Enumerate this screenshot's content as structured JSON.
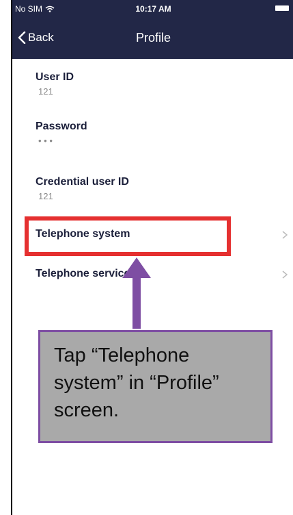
{
  "status_bar": {
    "carrier": "No SIM",
    "time": "10:17 AM"
  },
  "nav": {
    "back_label": "Back",
    "title": "Profile"
  },
  "items": [
    {
      "label": "User ID",
      "value": "121"
    },
    {
      "label": "Password",
      "value": "• • •"
    },
    {
      "label": "Credential user ID",
      "value": "121"
    },
    {
      "label": "Telephone system"
    },
    {
      "label": "Telephone service"
    }
  ],
  "callout": {
    "text": "Tap “Telephone system” in “Profile” screen."
  },
  "colors": {
    "navbar": "#222747",
    "highlight": "#e53030",
    "pointer": "#7e4ea3",
    "callout_bg": "#a9a9a9"
  }
}
